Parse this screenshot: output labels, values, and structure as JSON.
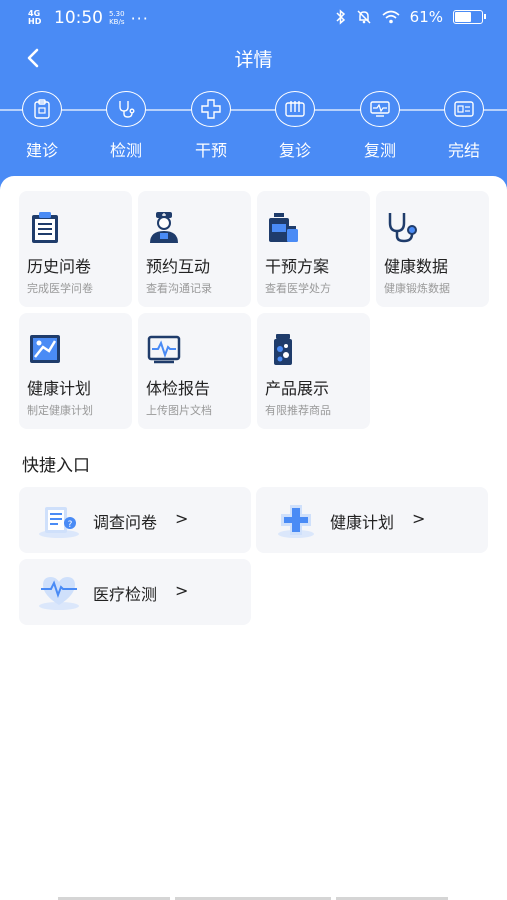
{
  "status_bar": {
    "signal": "4G HD",
    "time": "10:50",
    "net_speed_value": "5.30",
    "net_speed_unit": "KB/s",
    "more": "···",
    "battery": "61%"
  },
  "nav": {
    "title": "详情"
  },
  "steps": [
    {
      "label": "建诊",
      "icon": "clipboard-icon"
    },
    {
      "label": "检测",
      "icon": "stethoscope-icon"
    },
    {
      "label": "干预",
      "icon": "medical-cross-icon"
    },
    {
      "label": "复诊",
      "icon": "calendar-icon"
    },
    {
      "label": "复测",
      "icon": "monitor-icon"
    },
    {
      "label": "完结",
      "icon": "id-card-icon"
    }
  ],
  "tiles": [
    {
      "title": "历史问卷",
      "subtitle": "完成医学问卷",
      "icon": "questionnaire-icon"
    },
    {
      "title": "预约互动",
      "subtitle": "查看沟通记录",
      "icon": "doctor-icon"
    },
    {
      "title": "干预方案",
      "subtitle": "查看医学处方",
      "icon": "medicine-icon"
    },
    {
      "title": "健康数据",
      "subtitle": "健康锻炼数据",
      "icon": "stethoscope-icon"
    },
    {
      "title": "健康计划",
      "subtitle": "制定健康计划",
      "icon": "fitness-icon"
    },
    {
      "title": "体检报告",
      "subtitle": "上传图片文档",
      "icon": "ecg-report-icon"
    },
    {
      "title": "产品展示",
      "subtitle": "有限推荐商品",
      "icon": "pill-bottle-icon"
    }
  ],
  "quick_access": {
    "title": "快捷入口",
    "items": [
      {
        "label": "调查问卷",
        "icon": "survey-icon"
      },
      {
        "label": "健康计划",
        "icon": "health-cross-icon"
      },
      {
        "label": "医疗检测",
        "icon": "heart-monitor-icon"
      }
    ],
    "arrow": ">"
  },
  "colors": {
    "primary": "#4a8bf5",
    "icon_dark": "#1f3c6b",
    "tile_bg": "#f5f6f9"
  }
}
